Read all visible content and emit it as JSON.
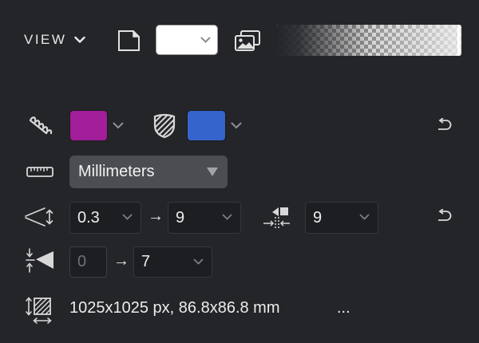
{
  "view": {
    "label": "VIEW"
  },
  "background": {
    "color": "#ffffff"
  },
  "fill": {
    "color": "#a21e9b"
  },
  "outline": {
    "color": "#3565cc"
  },
  "units": {
    "selected": "Millimeters"
  },
  "stroke": {
    "from": "0.3",
    "arrow": "→",
    "to": "9",
    "offset": "9"
  },
  "taper": {
    "from": "0",
    "arrow": "→",
    "to": "7"
  },
  "size": {
    "text": "1025x1025 px, 86.8x86.8 mm",
    "more": "..."
  }
}
